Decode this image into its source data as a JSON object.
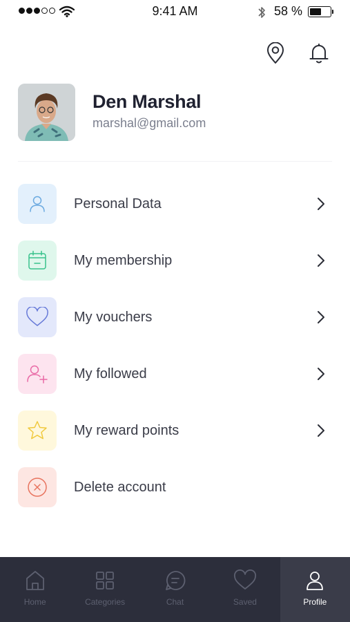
{
  "status_bar": {
    "time": "9:41 AM",
    "battery_percent": "58 %",
    "battery_level": 0.58,
    "signal_bars_filled": 3,
    "signal_bars_total": 5
  },
  "profile": {
    "name": "Den Marshal",
    "email": "marshal@gmail.com"
  },
  "menu": [
    {
      "label": "Personal Data",
      "icon": "user-icon",
      "bg": "#e3f0fc",
      "color": "#6aa9e0",
      "chevron": true
    },
    {
      "label": "My membership",
      "icon": "calendar-icon",
      "bg": "#dff7ec",
      "color": "#38c28c",
      "chevron": true
    },
    {
      "label": "My vouchers",
      "icon": "heart-icon",
      "bg": "#e3e8fb",
      "color": "#6679d8",
      "chevron": true
    },
    {
      "label": "My followed",
      "icon": "user-plus-icon",
      "bg": "#fde4ef",
      "color": "#e96aa6",
      "chevron": true
    },
    {
      "label": "My reward points",
      "icon": "star-icon",
      "bg": "#fff8dc",
      "color": "#f0c93d",
      "chevron": true
    },
    {
      "label": "Delete account",
      "icon": "close-circle-icon",
      "bg": "#fde6e2",
      "color": "#e8735e",
      "chevron": false
    }
  ],
  "tabs": [
    {
      "label": "Home",
      "icon": "home-icon",
      "active": false
    },
    {
      "label": "Categories",
      "icon": "grid-icon",
      "active": false
    },
    {
      "label": "Chat",
      "icon": "chat-icon",
      "active": false
    },
    {
      "label": "Saved",
      "icon": "heart-icon",
      "active": false
    },
    {
      "label": "Profile",
      "icon": "user-icon",
      "active": true
    }
  ],
  "colors": {
    "tab_bar_bg": "#2c2e3b",
    "tab_active_bg": "#3a3c49",
    "name_text": "#1f2130",
    "email_text": "#7b7f8e"
  }
}
